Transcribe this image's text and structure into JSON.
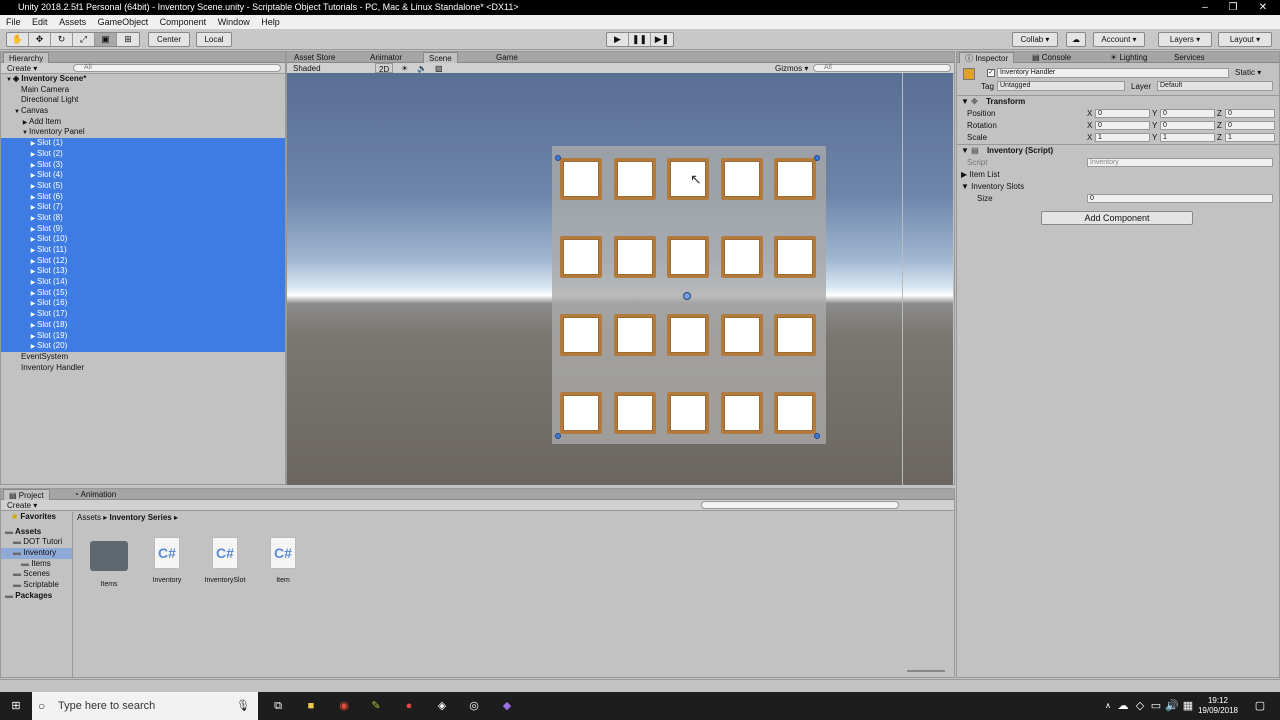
{
  "window": {
    "title": "Unity 2018.2.5f1 Personal (64bit) - Inventory Scene.unity - Scriptable Object Tutorials - PC, Mac & Linux Standalone* <DX11>"
  },
  "menu": [
    "File",
    "Edit",
    "Assets",
    "GameObject",
    "Component",
    "Window",
    "Help"
  ],
  "toolbar": {
    "pivot_center": "Center",
    "pivot_local": "Local",
    "collab": "Collab ▾",
    "account": "Account ▾",
    "layers": "Layers ▾",
    "layout": "Layout ▾"
  },
  "hierarchy": {
    "tab": "Hierarchy",
    "create": "Create ▾",
    "search_placeholder": "All",
    "scene": "Inventory Scene*",
    "items": [
      {
        "label": "Main Camera",
        "indent": 1,
        "arrow": "",
        "sel": false
      },
      {
        "label": "Directional Light",
        "indent": 1,
        "arrow": "",
        "sel": false
      },
      {
        "label": "Canvas",
        "indent": 1,
        "arrow": "▼",
        "sel": false
      },
      {
        "label": "Add Item",
        "indent": 2,
        "arrow": "▶",
        "sel": false
      },
      {
        "label": "Inventory Panel",
        "indent": 2,
        "arrow": "▼",
        "sel": false
      },
      {
        "label": "Slot (1)",
        "indent": 3,
        "arrow": "▶",
        "sel": true
      },
      {
        "label": "Slot (2)",
        "indent": 3,
        "arrow": "▶",
        "sel": true
      },
      {
        "label": "Slot (3)",
        "indent": 3,
        "arrow": "▶",
        "sel": true
      },
      {
        "label": "Slot (4)",
        "indent": 3,
        "arrow": "▶",
        "sel": true
      },
      {
        "label": "Slot (5)",
        "indent": 3,
        "arrow": "▶",
        "sel": true
      },
      {
        "label": "Slot (6)",
        "indent": 3,
        "arrow": "▶",
        "sel": true
      },
      {
        "label": "Slot (7)",
        "indent": 3,
        "arrow": "▶",
        "sel": true
      },
      {
        "label": "Slot (8)",
        "indent": 3,
        "arrow": "▶",
        "sel": true
      },
      {
        "label": "Slot (9)",
        "indent": 3,
        "arrow": "▶",
        "sel": true
      },
      {
        "label": "Slot (10)",
        "indent": 3,
        "arrow": "▶",
        "sel": true
      },
      {
        "label": "Slot (11)",
        "indent": 3,
        "arrow": "▶",
        "sel": true
      },
      {
        "label": "Slot (12)",
        "indent": 3,
        "arrow": "▶",
        "sel": true
      },
      {
        "label": "Slot (13)",
        "indent": 3,
        "arrow": "▶",
        "sel": true
      },
      {
        "label": "Slot (14)",
        "indent": 3,
        "arrow": "▶",
        "sel": true
      },
      {
        "label": "Slot (15)",
        "indent": 3,
        "arrow": "▶",
        "sel": true
      },
      {
        "label": "Slot (16)",
        "indent": 3,
        "arrow": "▶",
        "sel": true
      },
      {
        "label": "Slot (17)",
        "indent": 3,
        "arrow": "▶",
        "sel": true
      },
      {
        "label": "Slot (18)",
        "indent": 3,
        "arrow": "▶",
        "sel": true
      },
      {
        "label": "Slot (19)",
        "indent": 3,
        "arrow": "▶",
        "sel": true
      },
      {
        "label": "Slot (20)",
        "indent": 3,
        "arrow": "▶",
        "sel": true
      },
      {
        "label": "EventSystem",
        "indent": 1,
        "arrow": "",
        "sel": false
      },
      {
        "label": "Inventory Handler",
        "indent": 1,
        "arrow": "",
        "sel": false
      }
    ]
  },
  "scene_tabs": [
    "Asset Store",
    "Animator",
    "Scene",
    "Game"
  ],
  "scene_bar": {
    "shading": "Shaded",
    "mode2d": "2D",
    "gizmos": "Gizmos ▾",
    "search_placeholder": "All"
  },
  "inspector": {
    "tabs": [
      "Inspector",
      "Console",
      "Lighting",
      "Services"
    ],
    "object_name": "Inventory Handler",
    "static_label": "Static ▾",
    "tag_label": "Tag",
    "tag_value": "Untagged",
    "layer_label": "Layer",
    "layer_value": "Default",
    "transform_title": "Transform",
    "position_label": "Position",
    "rotation_label": "Rotation",
    "scale_label": "Scale",
    "position": [
      "0",
      "0",
      "0"
    ],
    "rotation": [
      "0",
      "0",
      "0"
    ],
    "scale": [
      "1",
      "1",
      "1"
    ],
    "script_component_title": "Inventory (Script)",
    "script_label": "Script",
    "script_value": "Inventory",
    "item_list_label": "Item List",
    "inventory_slots_label": "Inventory Slots",
    "size_label": "Size",
    "size_value": "0",
    "add_component": "Add Component"
  },
  "project": {
    "tabs": [
      "Project",
      "Animation"
    ],
    "create": "Create ▾",
    "favorites": "Favorites",
    "breadcrumb": [
      "Assets",
      "Inventory Series"
    ],
    "tree": [
      {
        "label": "Assets",
        "indent": 0,
        "bold": true
      },
      {
        "label": "DOT Tutori",
        "indent": 1,
        "bold": false
      },
      {
        "label": "Inventory",
        "indent": 1,
        "bold": false,
        "sel": true
      },
      {
        "label": "Items",
        "indent": 2,
        "bold": false
      },
      {
        "label": "Scenes",
        "indent": 1,
        "bold": false
      },
      {
        "label": "Scriptable",
        "indent": 1,
        "bold": false
      },
      {
        "label": "Packages",
        "indent": 0,
        "bold": true
      }
    ],
    "assets": [
      {
        "label": "Items",
        "type": "folder"
      },
      {
        "label": "Inventory",
        "type": "cs"
      },
      {
        "label": "InventorySlot",
        "type": "cs"
      },
      {
        "label": "Item",
        "type": "cs"
      }
    ]
  },
  "taskbar": {
    "search_placeholder": "Type here to search",
    "time": "19:12",
    "date": "19/09/2018"
  }
}
